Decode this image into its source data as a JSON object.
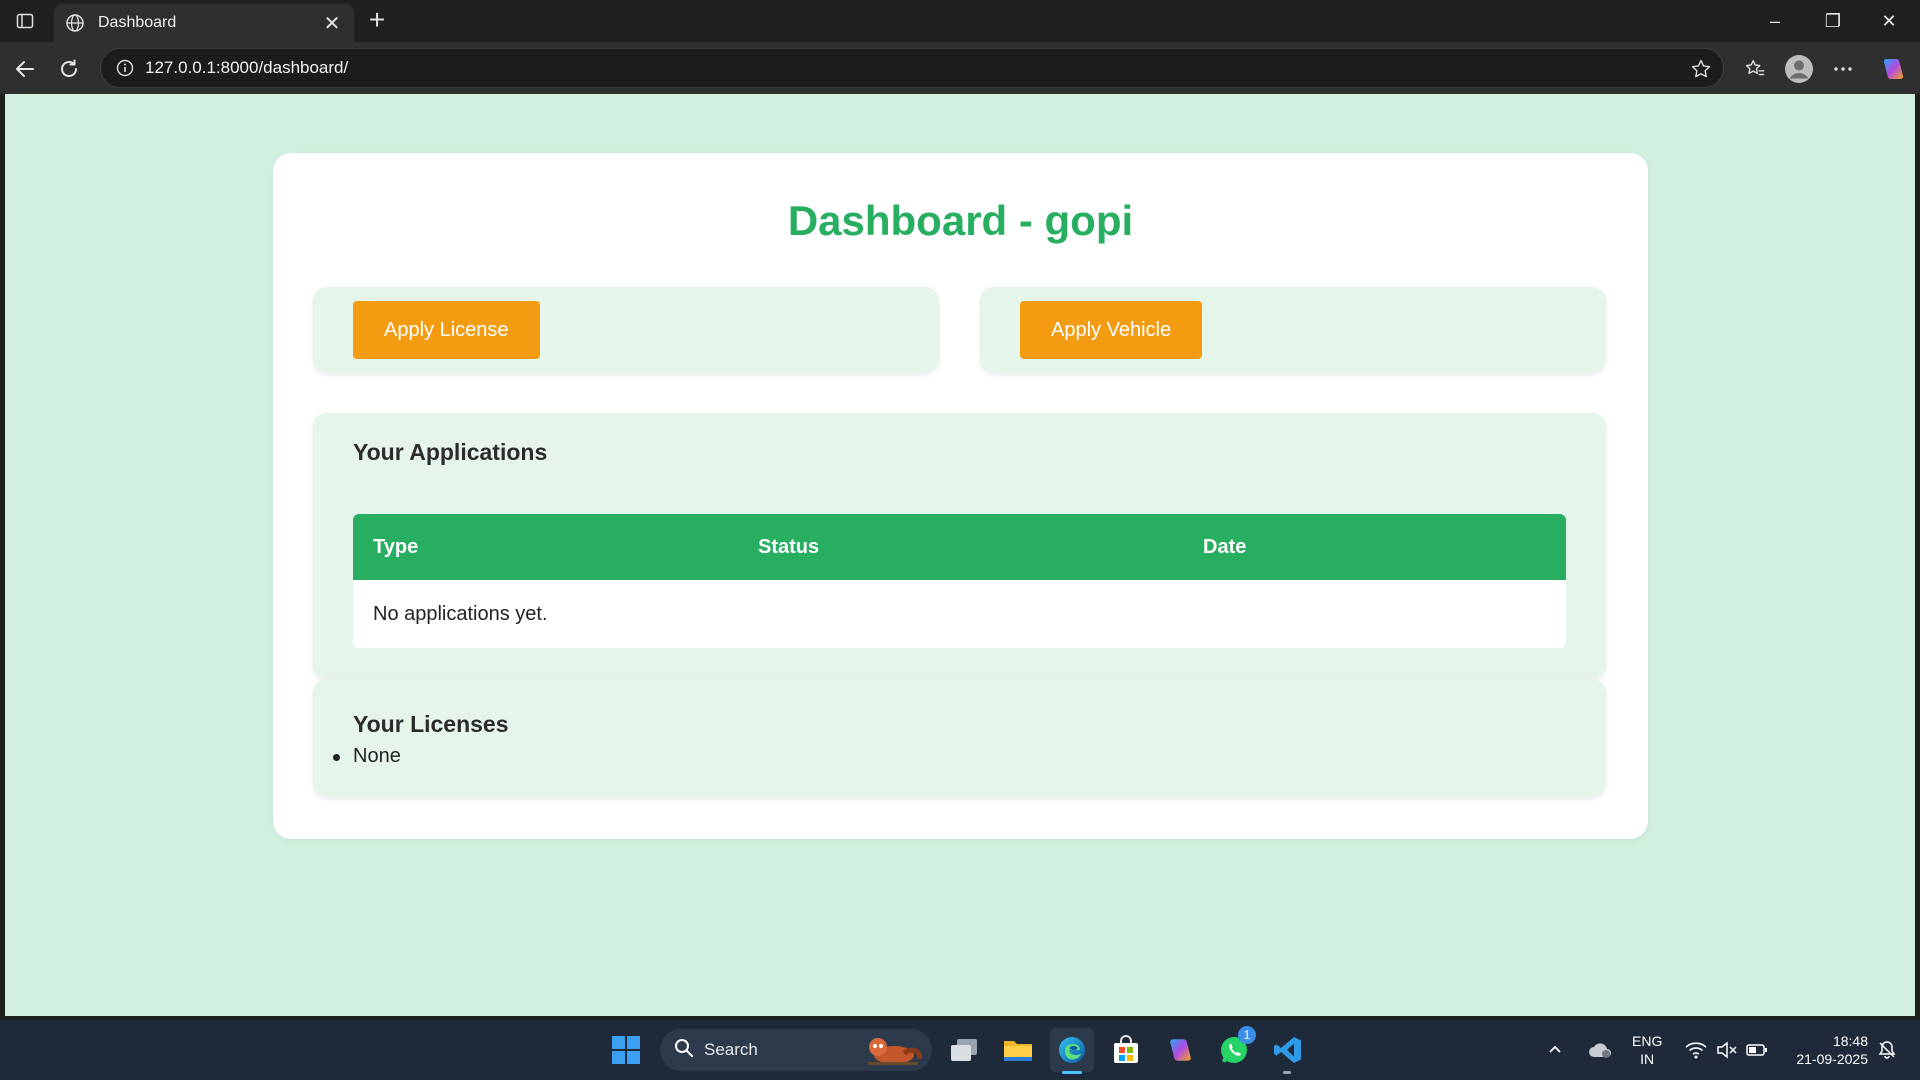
{
  "browser": {
    "tab_title": "Dashboard",
    "url": "127.0.0.1:8000/dashboard/"
  },
  "page": {
    "title": "Dashboard - gopi",
    "apply_license_label": "Apply License",
    "apply_vehicle_label": "Apply Vehicle",
    "applications": {
      "heading": "Your Applications",
      "columns": [
        "Type",
        "Status",
        "Date"
      ],
      "empty_message": "No applications yet."
    },
    "licenses": {
      "heading": "Your Licenses",
      "items": [
        "None"
      ]
    }
  },
  "taskbar": {
    "search_label": "Search",
    "language": "ENG",
    "region": "IN",
    "time": "18:48",
    "date": "21-09-2025",
    "whatsapp_badge": "1"
  },
  "colors": {
    "accent_green": "#27ae60",
    "button_orange": "#f39c12",
    "page_bg": "#d1f0df",
    "panel_bg": "#e6f5ea"
  }
}
